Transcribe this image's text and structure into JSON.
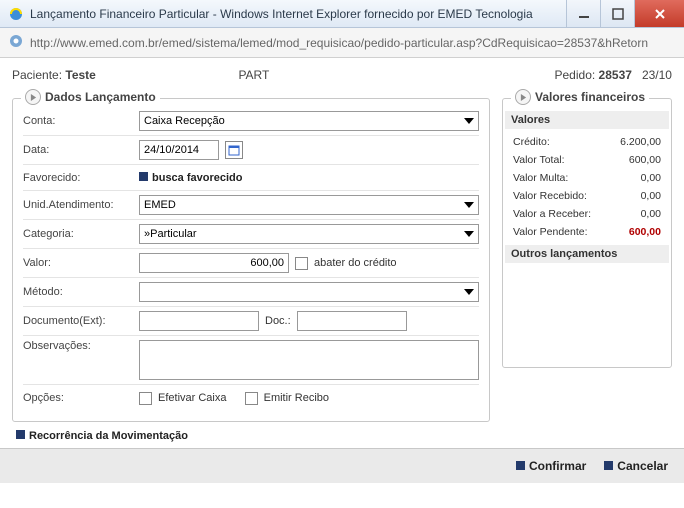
{
  "window": {
    "title": "Lançamento Financeiro Particular - Windows Internet Explorer fornecido por EMED Tecnologia",
    "url": "http://www.emed.com.br/emed/sistema/lemed/mod_requisicao/pedido-particular.asp?CdRequisicao=28537&hRetorn"
  },
  "header": {
    "paciente_label": "Paciente:",
    "paciente_value": "Teste",
    "mid": "PART",
    "pedido_label": "Pedido:",
    "pedido_value": "28537",
    "date_frag": "23/10"
  },
  "panel_dados": {
    "title": "Dados Lançamento"
  },
  "panel_valores": {
    "title": "Valores financeiros"
  },
  "labels": {
    "conta": "Conta:",
    "data": "Data:",
    "favorecido": "Favorecido:",
    "unid": "Unid.Atendimento:",
    "categoria": "Categoria:",
    "valor": "Valor:",
    "metodo": "Método:",
    "docext": "Documento(Ext):",
    "doc": "Doc.:",
    "obs": "Observações:",
    "opcoes": "Opções:",
    "abater": "abater do crédito",
    "efetivar": "Efetivar Caixa",
    "emitir": "Emitir Recibo",
    "busca": "busca favorecido",
    "recorrencia": "Recorrência da Movimentação"
  },
  "values": {
    "conta": "Caixa Recepção",
    "data": "24/10/2014",
    "unid": "EMED",
    "categoria": "    »Particular",
    "valor": "600,00"
  },
  "financeiro": {
    "valores_title": "Valores",
    "outros_title": "Outros lançamentos",
    "rows": [
      {
        "label": "Crédito:",
        "value": "6.200,00"
      },
      {
        "label": "Valor Total:",
        "value": "600,00"
      },
      {
        "label": "Valor Multa:",
        "value": "0,00"
      },
      {
        "label": "Valor Recebido:",
        "value": "0,00"
      },
      {
        "label": "Valor a Receber:",
        "value": "0,00"
      },
      {
        "label": "Valor Pendente:",
        "value": "600,00",
        "red": true
      }
    ]
  },
  "footer": {
    "confirmar": "Confirmar",
    "cancelar": "Cancelar"
  }
}
